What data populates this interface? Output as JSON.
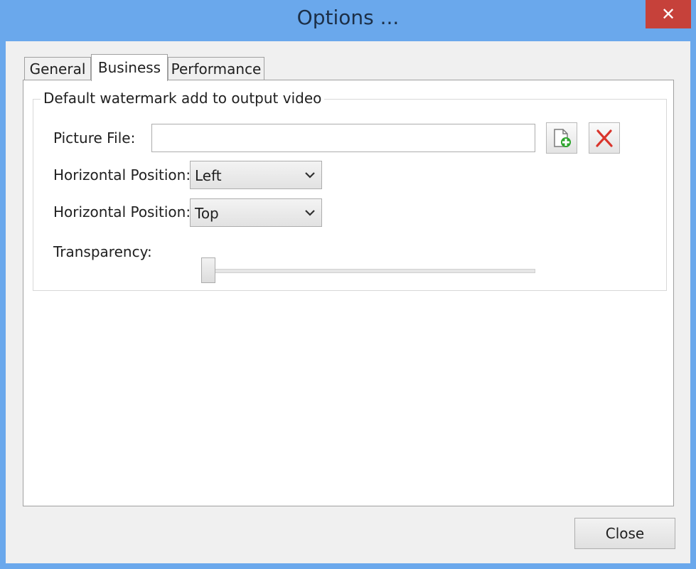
{
  "window": {
    "title": "Options ...",
    "close_glyph": "✕"
  },
  "tabs": [
    {
      "label": "General",
      "active": false
    },
    {
      "label": "Business",
      "active": true
    },
    {
      "label": "Performance",
      "active": false
    }
  ],
  "watermark": {
    "group_title": "Default watermark add to output video",
    "picture_file_label": "Picture File:",
    "picture_file_value": "",
    "add_icon": "add-file-icon",
    "remove_icon": "red-x-icon",
    "horizontal_label": "Horizontal Position:",
    "horizontal_value": "Left",
    "vertical_label": "Horizontal Position:",
    "vertical_value": "Top",
    "transparency_label": "Transparency:",
    "transparency_value": 0
  },
  "footer": {
    "close_label": "Close"
  },
  "colors": {
    "title_bar": "#6aa8ec",
    "close_button_red": "#c6413a",
    "add_icon_green": "#2ea52e",
    "remove_icon_red": "#d9342b"
  }
}
